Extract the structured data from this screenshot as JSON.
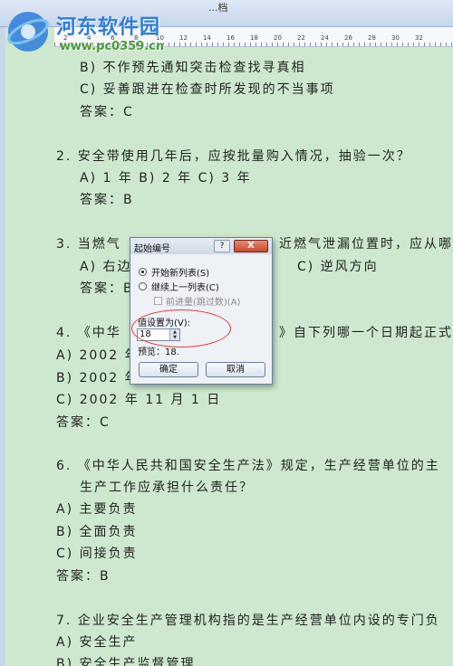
{
  "watermark": {
    "title": "河东软件园",
    "url": "www.pc0359.cn"
  },
  "titlebar": {
    "title": "...档"
  },
  "ruler": {
    "ticks": [
      "2",
      "4",
      "6",
      "8",
      "10",
      "12",
      "14",
      "16",
      "18",
      "20",
      "22",
      "24",
      "26",
      "28",
      "30",
      "32"
    ]
  },
  "document": {
    "lines": [
      "B) 不作预先通知突击检查找寻真相",
      "C) 妥善跟进在检查时所发现的不当事项",
      "答案：C",
      "2. 安全带使用几年后，应按批量购入情况，抽验一次？",
      "A) 1 年        B) 2 年          C) 3 年",
      "答案：B",
      "3. 当燃气",
      "近燃气泄漏位置时，应从哪",
      "A) 右边",
      "C) 逆风方向",
      "答案：B",
      "4. 《中华",
      "》自下列哪一个日期起正式",
      "A)  2002 年",
      "B)  2002 年",
      "C)  2002 年 11 月 1 日",
      "答案：C",
      "6. 《中华人民共和国安全生产法》规定，生产经营单位的主",
      "生产工作应承担什么责任？",
      "A)    主要负责",
      "B)    全面负责",
      "C)    间接负责",
      "答案：B",
      "7. 企业安全生产管理机构指的是生产经营单位内设的专门负",
      "A)    安全生产",
      "B)    安全生产监督管理"
    ]
  },
  "dialog": {
    "title": "起始编号",
    "help_label": "?",
    "close_label": "X",
    "option_new_list": "开始新列表(S)",
    "option_continue": "继续上一列表(C)",
    "option_advance": "前进量(跳过数)(A)",
    "value_label": "值设置为(V):",
    "value": "18",
    "preview_label": "预览：18.",
    "ok_label": "确定",
    "cancel_label": "取消"
  }
}
